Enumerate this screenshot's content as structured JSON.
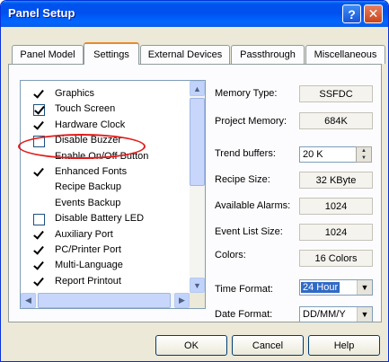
{
  "window": {
    "title": "Panel Setup",
    "help_glyph": "?",
    "close_glyph": "✕"
  },
  "tabs": [
    {
      "label": "Panel Model",
      "active": false
    },
    {
      "label": "Settings",
      "active": true
    },
    {
      "label": "External Devices",
      "active": false
    },
    {
      "label": "Passthrough",
      "active": false
    },
    {
      "label": "Miscellaneous",
      "active": false
    }
  ],
  "settings_list": [
    {
      "label": "Graphics",
      "mark": "tick"
    },
    {
      "label": "Touch Screen",
      "mark": "boxtick"
    },
    {
      "label": "Hardware Clock",
      "mark": "tick"
    },
    {
      "label": "Disable Buzzer",
      "mark": "box"
    },
    {
      "label": "Enable On/Off Button",
      "mark": "none"
    },
    {
      "label": "Enhanced Fonts",
      "mark": "tick"
    },
    {
      "label": "Recipe Backup",
      "mark": "none"
    },
    {
      "label": "Events Backup",
      "mark": "none"
    },
    {
      "label": "Disable Battery LED",
      "mark": "box"
    },
    {
      "label": "Auxiliary Port",
      "mark": "tick"
    },
    {
      "label": "PC/Printer Port",
      "mark": "tick"
    },
    {
      "label": "Multi-Language",
      "mark": "tick"
    },
    {
      "label": "Report Printout",
      "mark": "tick"
    }
  ],
  "properties": {
    "memory_type": {
      "label": "Memory Type:",
      "value": "SSFDC"
    },
    "project_memory": {
      "label": "Project Memory:",
      "value": "684K"
    },
    "trend_buffers": {
      "label": "Trend buffers:",
      "value": "20 K"
    },
    "recipe_size": {
      "label": "Recipe Size:",
      "value": "32 KByte"
    },
    "available_alarms": {
      "label": "Available Alarms:",
      "value": "1024"
    },
    "event_list_size": {
      "label": "Event List Size:",
      "value": "1024"
    },
    "colors": {
      "label": "Colors:",
      "value": "16 Colors"
    },
    "time_format": {
      "label": "Time Format:",
      "value": "24 Hour"
    },
    "date_format": {
      "label": "Date Format:",
      "value": "DD/MM/Y"
    }
  },
  "buttons": {
    "ok": "OK",
    "cancel": "Cancel",
    "help": "Help"
  },
  "annotation": {
    "color": "#e21b1b",
    "target": "Disable Buzzer"
  },
  "colors": {
    "titlebar": "#0053ee",
    "dialog_bg": "#ece9d8",
    "tab_active_accent": "#e68b2c",
    "selection": "#316ac5"
  }
}
